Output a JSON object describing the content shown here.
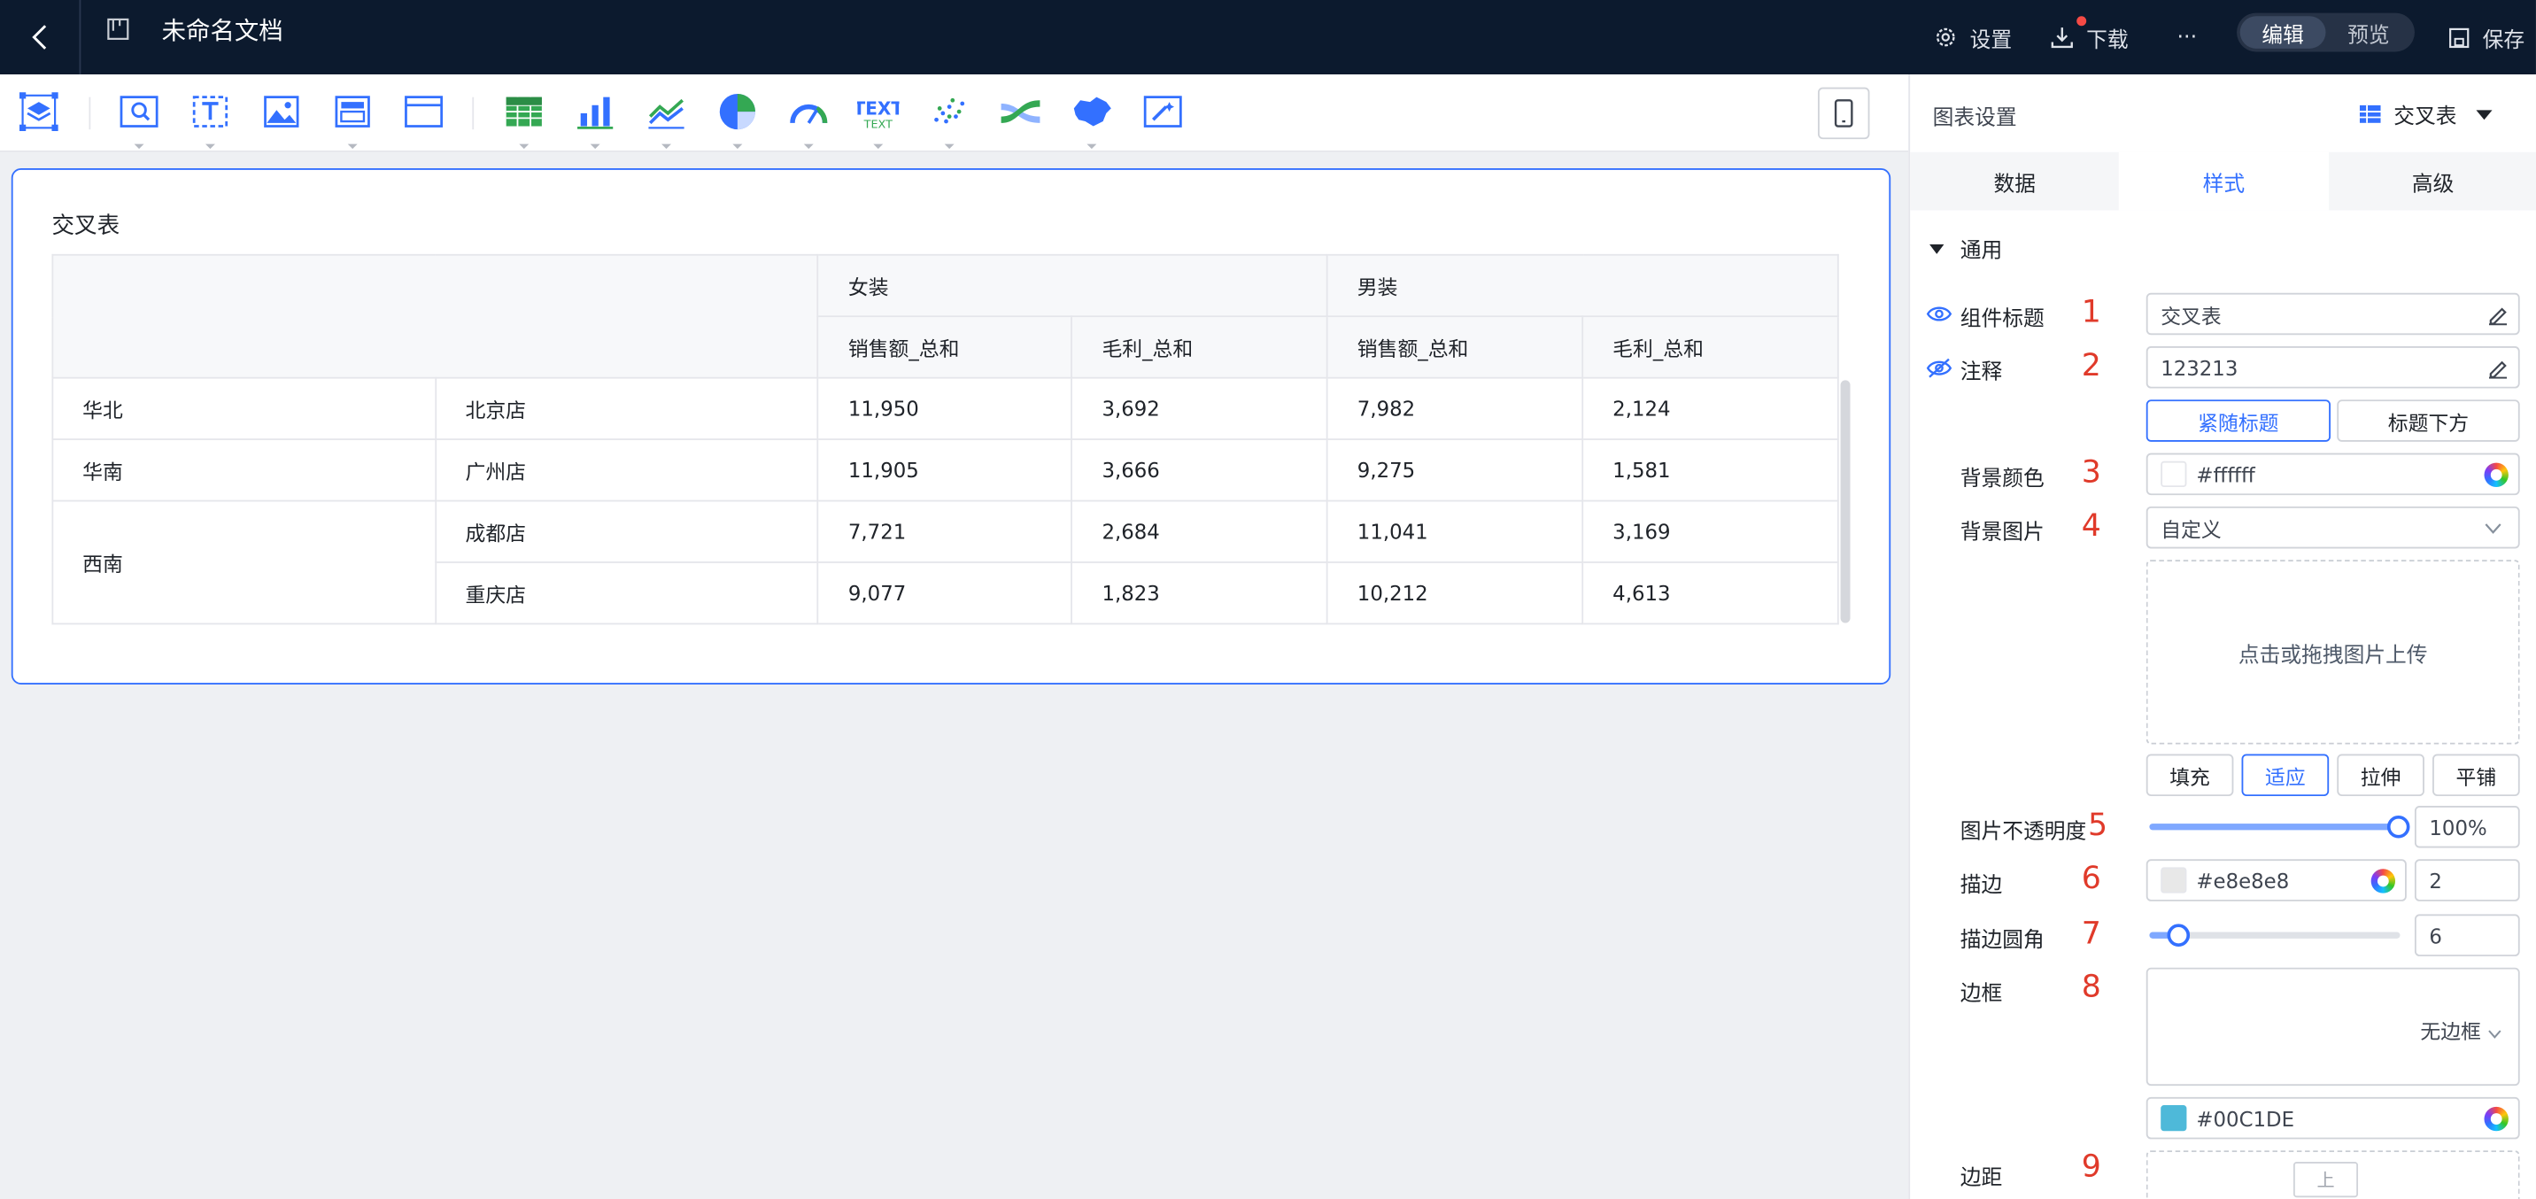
{
  "header": {
    "doc_title": "未命名文档",
    "settings_label": "设置",
    "download_label": "下载",
    "more_label": "···",
    "mode_edit": "编辑",
    "mode_preview": "预览",
    "save_label": "保存"
  },
  "toolbar": {
    "tools": [
      "layer-icon",
      "query-icon",
      "text-box-icon",
      "image-icon",
      "tab-icon",
      "container-icon",
      "table-icon",
      "bar-chart-icon",
      "line-chart-icon",
      "pie-chart-icon",
      "gauge-icon",
      "text-chart-icon",
      "scatter-icon",
      "sankey-icon",
      "map-icon",
      "magic-icon"
    ]
  },
  "widget": {
    "title": "交叉表",
    "col_groups": [
      "女装",
      "男装"
    ],
    "col_measures": [
      "销售额_总和",
      "毛利_总和",
      "销售额_总和",
      "毛利_总和"
    ],
    "rows": [
      {
        "region": "华北",
        "store": "北京店",
        "values": [
          "11,950",
          "3,692",
          "7,982",
          "2,124"
        ]
      },
      {
        "region": "华南",
        "store": "广州店",
        "values": [
          "11,905",
          "3,666",
          "9,275",
          "1,581"
        ]
      },
      {
        "region": "西南",
        "store": "成都店",
        "values": [
          "7,721",
          "2,684",
          "11,041",
          "3,169"
        ]
      },
      {
        "region": "",
        "store": "重庆店",
        "values": [
          "9,077",
          "1,823",
          "10,212",
          "4,613"
        ]
      }
    ]
  },
  "panel": {
    "title": "图表设置",
    "chart_type": "交叉表",
    "tabs": [
      "数据",
      "样式",
      "高级"
    ],
    "active_tab": "样式",
    "section": "通用",
    "component_title_label": "组件标题",
    "component_title_value": "交叉表",
    "note_label": "注释",
    "note_value": "123213",
    "note_pos_follow": "紧随标题",
    "note_pos_below": "标题下方",
    "bg_color_label": "背景颜色",
    "bg_color_value": "#ffffff",
    "bg_image_label": "背景图片",
    "bg_image_value": "自定义",
    "upload_hint": "点击或拖拽图片上传",
    "fit_fill": "填充",
    "fit_adapt": "适应",
    "fit_stretch": "拉伸",
    "fit_tile": "平铺",
    "opacity_label": "图片不透明度",
    "opacity_value": "100%",
    "opacity_level": 1.0,
    "stroke_label": "描边",
    "stroke_color": "#e8e8e8",
    "stroke_width": "2",
    "radius_label": "描边圆角",
    "radius_value": "6",
    "border_label": "边框",
    "border_value": "无边框",
    "border_color": "#00C1DE",
    "margin_label": "边距",
    "margin_top": "上",
    "annotations": [
      "1",
      "2",
      "3",
      "4",
      "5",
      "6",
      "7",
      "8",
      "9"
    ]
  },
  "colors": {
    "accent": "#3370ff",
    "topbar": "#0c1a2e",
    "annotation": "#e03a2a"
  }
}
